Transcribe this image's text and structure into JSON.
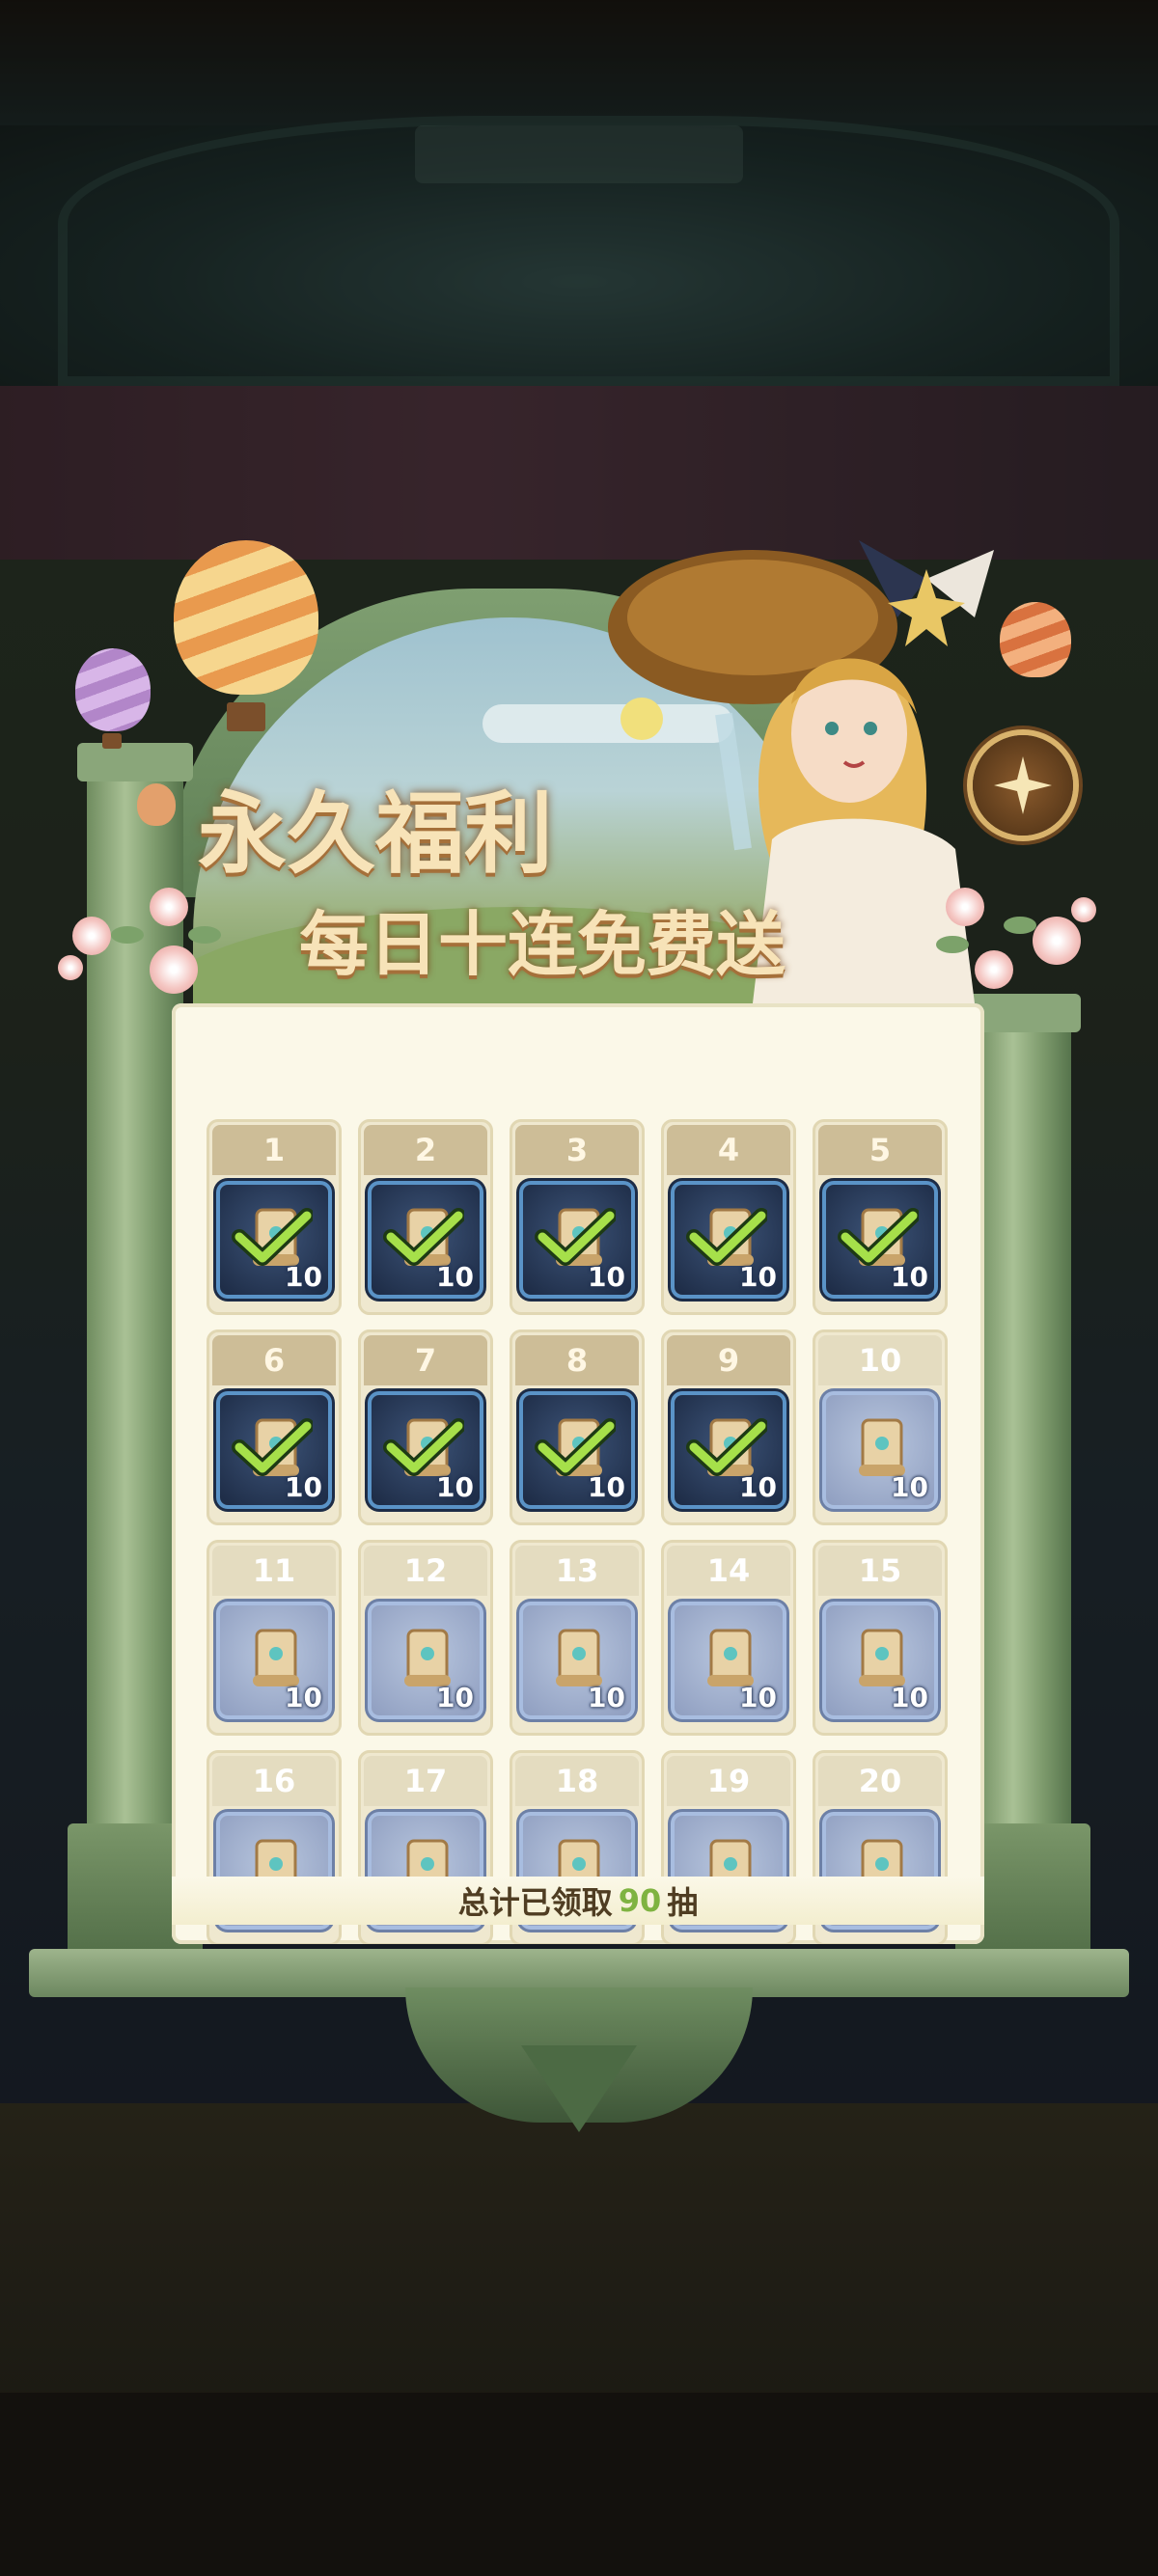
{
  "header": {
    "title_line1": "永久福利",
    "title_line2": "每日十连免费送"
  },
  "close_button": {
    "icon": "star-close-icon"
  },
  "reward_days": [
    {
      "day": "1",
      "quantity": "10",
      "claimed": true
    },
    {
      "day": "2",
      "quantity": "10",
      "claimed": true
    },
    {
      "day": "3",
      "quantity": "10",
      "claimed": true
    },
    {
      "day": "4",
      "quantity": "10",
      "claimed": true
    },
    {
      "day": "5",
      "quantity": "10",
      "claimed": true
    },
    {
      "day": "6",
      "quantity": "10",
      "claimed": true
    },
    {
      "day": "7",
      "quantity": "10",
      "claimed": true
    },
    {
      "day": "8",
      "quantity": "10",
      "claimed": true
    },
    {
      "day": "9",
      "quantity": "10",
      "claimed": true
    },
    {
      "day": "10",
      "quantity": "10",
      "claimed": false
    },
    {
      "day": "11",
      "quantity": "10",
      "claimed": false
    },
    {
      "day": "12",
      "quantity": "10",
      "claimed": false
    },
    {
      "day": "13",
      "quantity": "10",
      "claimed": false
    },
    {
      "day": "14",
      "quantity": "10",
      "claimed": false
    },
    {
      "day": "15",
      "quantity": "10",
      "claimed": false
    },
    {
      "day": "16",
      "quantity": "10",
      "claimed": false
    },
    {
      "day": "17",
      "quantity": "10",
      "claimed": false
    },
    {
      "day": "18",
      "quantity": "10",
      "claimed": false
    },
    {
      "day": "19",
      "quantity": "10",
      "claimed": false
    },
    {
      "day": "20",
      "quantity": "10",
      "claimed": false
    }
  ],
  "summary": {
    "prefix": "总计已领取",
    "count": "90",
    "suffix": "抽"
  },
  "colors": {
    "frame_green": "#7f9f71",
    "title_gold": "#f7e3b8",
    "count_green": "#7fb341",
    "claimed_tile": "#2a3d5e",
    "open_tile": "#a8b6d4"
  }
}
